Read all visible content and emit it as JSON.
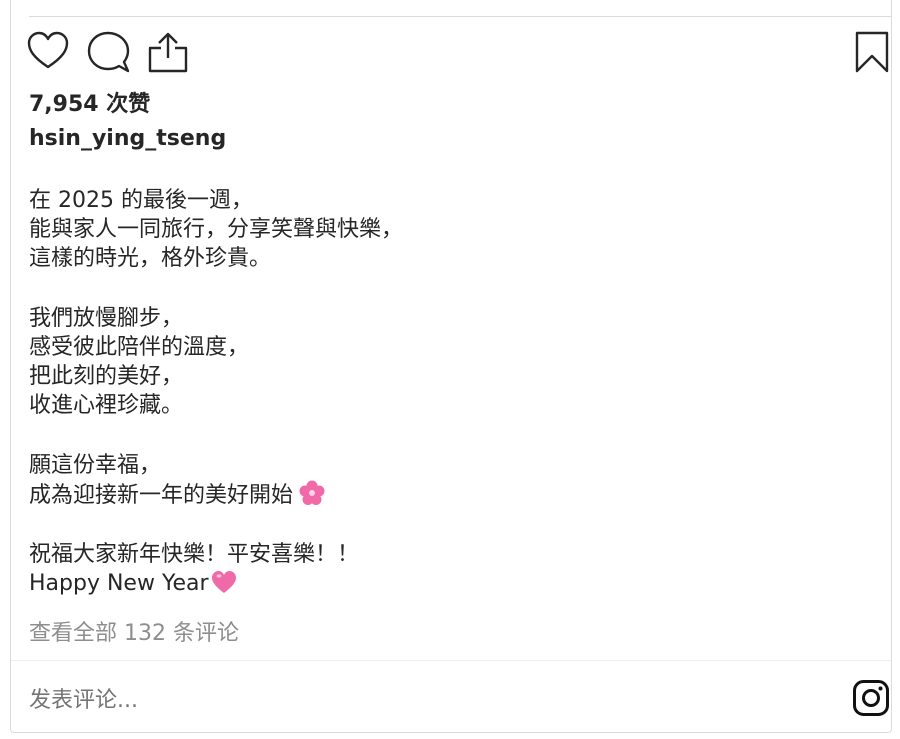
{
  "post": {
    "likes_text": "7,954 次赞",
    "username": "hsin_ying_tseng",
    "caption_paragraphs": [
      [
        "在 2025 的最後一週，",
        "能與家人一同旅行，分享笑聲與快樂，",
        "這樣的時光，格外珍貴。"
      ],
      [
        "我們放慢腳步，",
        "感受彼此陪伴的溫度，",
        "把此刻的美好，",
        "收進心裡珍藏。"
      ],
      [
        "願這份幸福，",
        "成為迎接新一年的美好開始"
      ],
      [
        "祝福大家新年快樂！平安喜樂！！",
        "Happy New Year"
      ]
    ],
    "view_all_comments": "查看全部 132 条评论"
  },
  "comment_box": {
    "placeholder": "发表评论..."
  },
  "icons": {
    "like": "heart-icon",
    "comment": "comment-bubble-icon",
    "share": "share-icon",
    "save": "bookmark-icon",
    "brand": "instagram-icon",
    "flower_emoji": "cherry-blossom-icon",
    "heart_emoji": "pink-heart-icon"
  },
  "colors": {
    "text": "#262626",
    "muted": "#8e8e8e",
    "border": "#dbdbdb",
    "emoji_pink": "#f06aa8"
  }
}
